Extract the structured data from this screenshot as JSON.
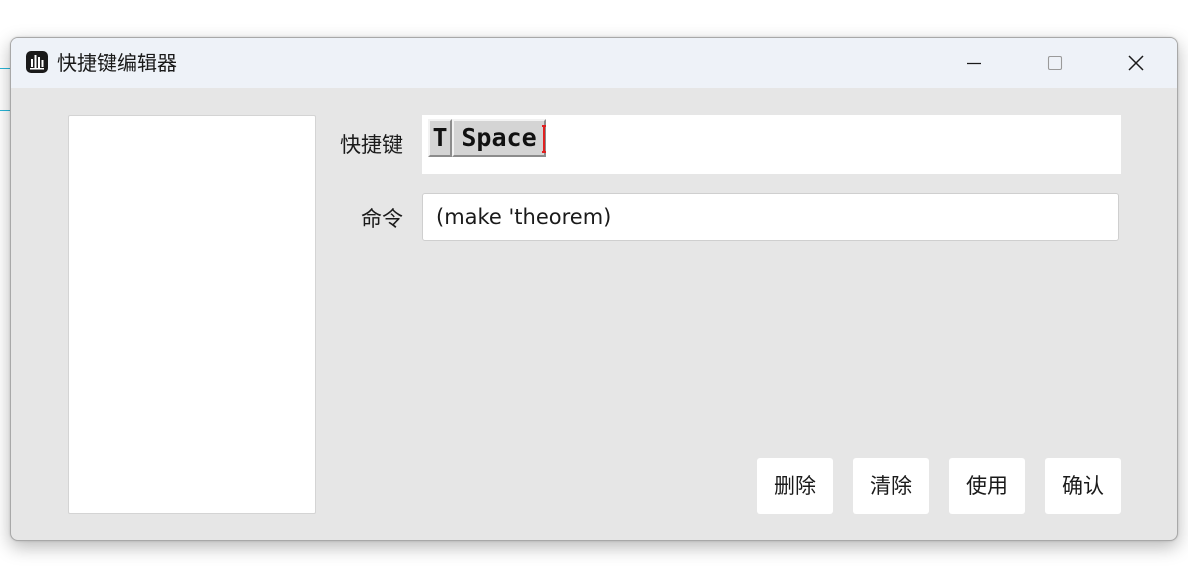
{
  "window": {
    "title": "快捷键编辑器"
  },
  "icons": {
    "app": "app-logo-icon",
    "minimize": "minimize-icon",
    "maximize": "maximize-icon",
    "close": "close-icon"
  },
  "form": {
    "shortcut_label": "快捷键",
    "shortcut_keys": [
      "T",
      "Space"
    ],
    "command_label": "命令",
    "command_value": "(make 'theorem)"
  },
  "buttons": {
    "delete": "删除",
    "clear": "清除",
    "apply": "使用",
    "confirm": "确认"
  },
  "colors": {
    "window_bg": "#e6e6e6",
    "titlebar_bg": "#eef2f8",
    "caret": "#e02020",
    "background_accent": "#29b6d8"
  }
}
